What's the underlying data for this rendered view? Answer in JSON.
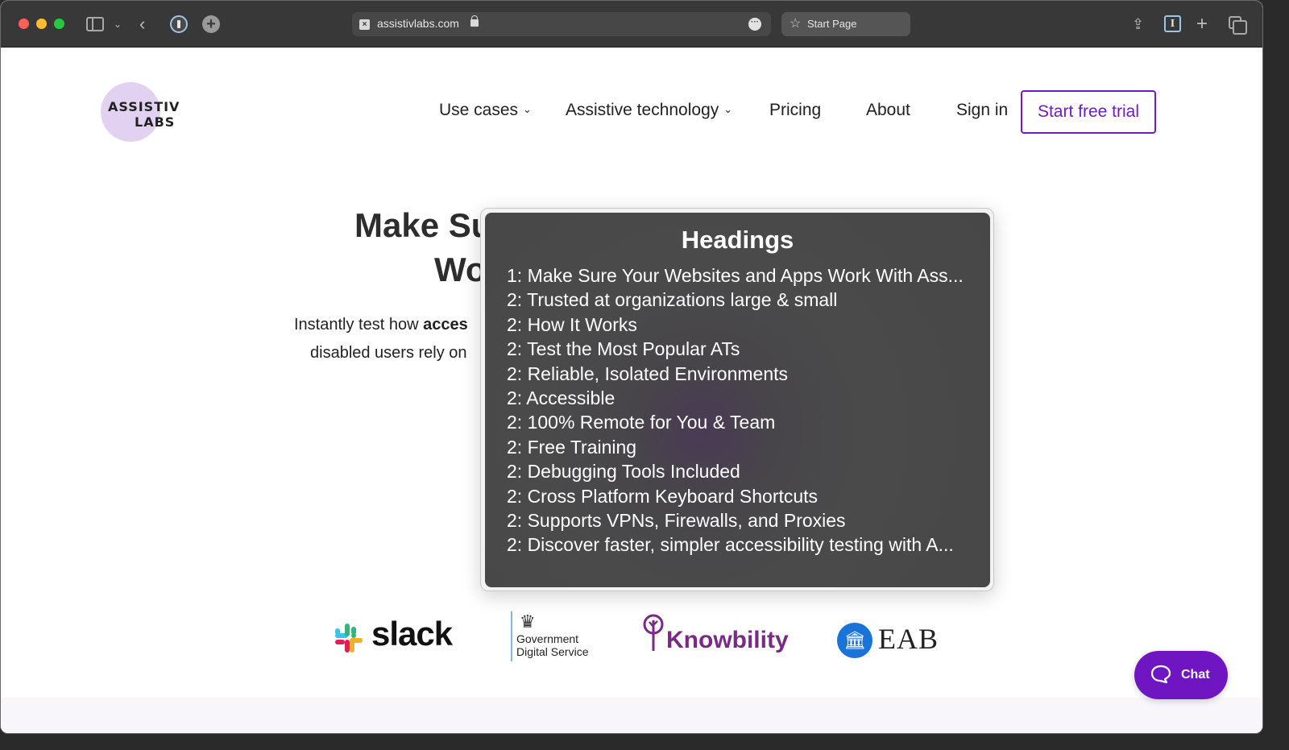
{
  "browser": {
    "url": "assistivlabs.com",
    "tab_label": "Start Page",
    "icons": {
      "sidebar": "sidebar-icon",
      "back": "chevron-left-icon",
      "password_manager": "1password-icon",
      "extension": "plus-circle-icon",
      "more": "ellipsis-icon",
      "share": "share-icon",
      "reader": "reader-icon",
      "new_tab": "plus-icon",
      "tab_overview": "tabs-icon"
    }
  },
  "site": {
    "logo": {
      "line1": "ASSISTIV",
      "line2": "LABS",
      "bg_color": "#e2d1f0"
    },
    "nav": {
      "items": [
        {
          "label": "Use cases",
          "has_dropdown": true
        },
        {
          "label": "Assistive technology",
          "has_dropdown": true
        },
        {
          "label": "Pricing",
          "has_dropdown": false
        },
        {
          "label": "About",
          "has_dropdown": false
        },
        {
          "label": "Sign in",
          "has_dropdown": false
        }
      ],
      "chevron": "⌄",
      "cta_label": "Start free trial",
      "accent_color": "#6f1bc9"
    },
    "hero": {
      "title_line1_visible": "Make Su",
      "title_line2_visible": "Wo",
      "subtitle_line1_prefix": "Instantly test how ",
      "subtitle_line1_bold": "acces",
      "subtitle_line2": "disabled users rely on"
    },
    "partners": [
      {
        "name": "slack",
        "label": "slack"
      },
      {
        "name": "gds",
        "line1": "Government",
        "line2": "Digital Service"
      },
      {
        "name": "knowbility",
        "label": "Knowbility"
      },
      {
        "name": "eab",
        "label": "EAB",
        "icon_glyph": "🏛"
      }
    ],
    "chat": {
      "label": "Chat",
      "color": "#6f16c2"
    }
  },
  "headings_overlay": {
    "title": "Headings",
    "items": [
      "1: Make Sure Your Websites and Apps Work With Ass...",
      "2: Trusted at organizations large & small",
      "2: How It Works",
      "2: Test the Most Popular ATs",
      "2: Reliable, Isolated Environments",
      "2: Accessible",
      "2: 100% Remote for You & Team",
      "2: Free Training",
      "2: Debugging Tools Included",
      "2: Cross Platform Keyboard Shortcuts",
      "2: Supports VPNs, Firewalls, and Proxies",
      "2: Discover faster, simpler accessibility testing with A..."
    ]
  }
}
